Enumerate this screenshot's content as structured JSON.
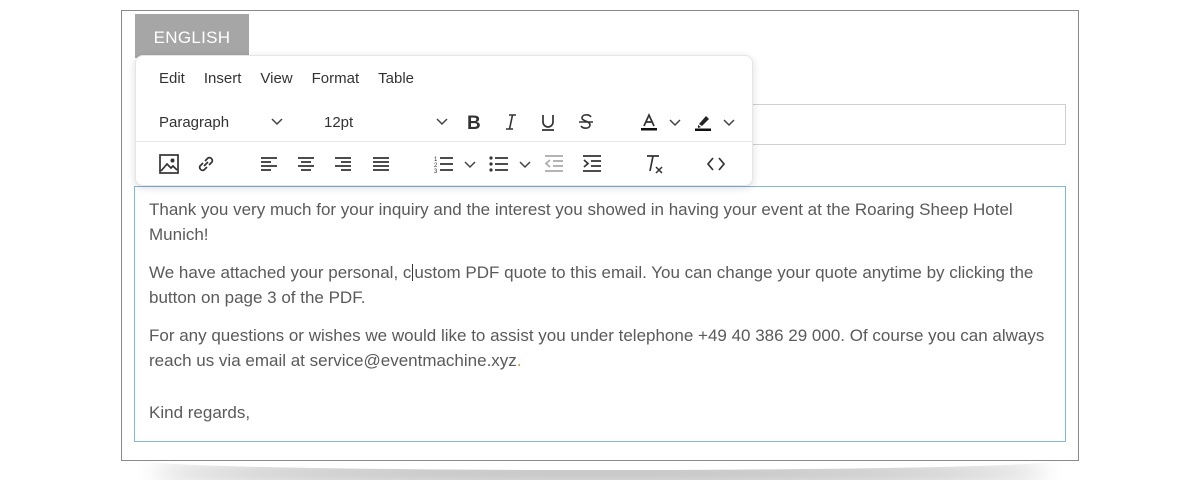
{
  "language_tab": {
    "label": "ENGLISH"
  },
  "menubar": {
    "items": [
      "Edit",
      "Insert",
      "View",
      "Format",
      "Table"
    ]
  },
  "toolbar": {
    "block_format": {
      "value": "Paragraph"
    },
    "font_size": {
      "value": "12pt"
    },
    "row1_icons": [
      "bold-icon",
      "italic-icon",
      "underline-icon",
      "strikethrough-icon",
      "text-color-icon",
      "highlight-color-icon"
    ],
    "row2_icons": [
      "image-icon",
      "link-icon",
      "align-left-icon",
      "align-center-icon",
      "align-right-icon",
      "align-justify-icon",
      "numbered-list-icon",
      "bullet-list-icon",
      "outdent-icon",
      "indent-icon",
      "clear-formatting-icon",
      "source-code-icon"
    ]
  },
  "editor": {
    "p1": "Thank you very much for your inquiry and the interest you showed in having your event at the Roaring Sheep Hotel Munich!",
    "p2_before_caret": "We have attached your personal, c",
    "p2_after_caret": "ustom PDF quote to this email. You can change your quote anytime by clicking the button on page 3 of the PDF.",
    "p3_main": "For any questions or wishes we would like to assist you under telephone +49 40 386 29 000. Of course you can always reach us via email at service@eventmachine.xyz",
    "p3_period": ".",
    "closing": "Kind regards,"
  },
  "colors": {
    "accent_border": "#7fb7e6",
    "tab_bg": "#a6a6a6"
  }
}
